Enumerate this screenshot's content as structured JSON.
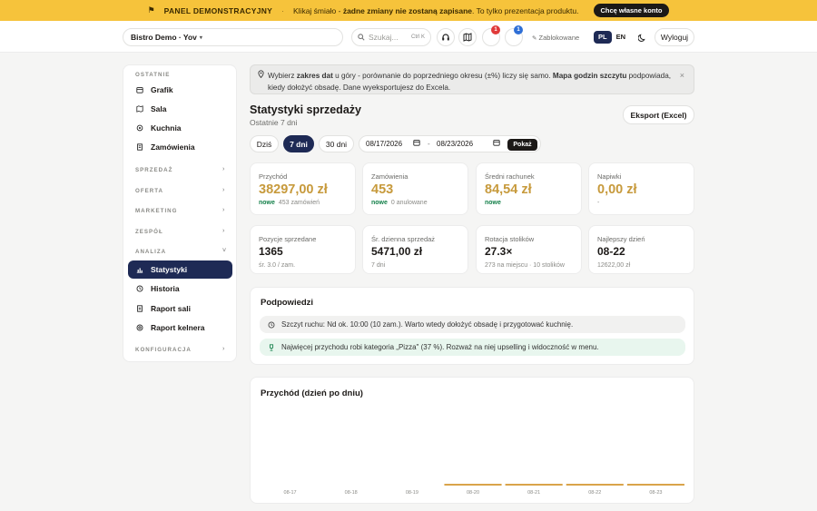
{
  "banner": {
    "flag": "⚑",
    "label": "PANEL DEMONSTRACYJNY",
    "sep": "·",
    "text_a": "Klikaj śmiało -",
    "text_bold": "żadne zmiany nie zostaną zapisane",
    "text_b": ". To tylko prezentacja produktu.",
    "cta": "Chcę własne konto"
  },
  "topbar": {
    "tenant": "Bistro Demo · Yov",
    "tenant_caret": "▾",
    "search_placeholder": "Szukaj...",
    "search_shortcut": "Ctrl K",
    "notif_count_a": "1",
    "notif_count_b": "1",
    "blocked": "Zablokowane",
    "blocked_icon": "✎",
    "lang_pl": "PL",
    "lang_en": "EN",
    "logout": "Wyloguj"
  },
  "sidebar": {
    "recent_title": "OSTATNIE",
    "recent": [
      {
        "label": "Grafik",
        "icon": "calendar-icon"
      },
      {
        "label": "Sala",
        "icon": "map-icon"
      },
      {
        "label": "Kuchnia",
        "icon": "kitchen-icon"
      },
      {
        "label": "Zamówienia",
        "icon": "receipt-icon"
      }
    ],
    "sections": [
      "SPRZEDAŻ",
      "OFERTA",
      "MARKETING",
      "ZESPÓŁ",
      "ANALIZA",
      "KONFIGURACJA"
    ],
    "analysis": [
      {
        "label": "Statystyki",
        "icon": "chart-icon",
        "active": true
      },
      {
        "label": "Historia",
        "icon": "clock-icon"
      },
      {
        "label": "Raport sali",
        "icon": "document-icon"
      },
      {
        "label": "Raport kelnera",
        "icon": "target-icon"
      }
    ]
  },
  "hint": {
    "a": "Wybierz ",
    "b": "zakres dat",
    "c": " u góry - porównanie do poprzedniego okresu (±%) liczy się samo. ",
    "d": "Mapa godzin szczytu",
    "e": " podpowiada, kiedy dołożyć obsadę. Dane wyeksportujesz do Excela.",
    "close": "×"
  },
  "header": {
    "title": "Statystyki sprzedaży",
    "subtitle": "Ostatnie 7 dni",
    "export": "Eksport (Excel)"
  },
  "filters": {
    "today": "Dziś",
    "d7": "7 dni",
    "d30": "30 dni",
    "from": "08/17/2026",
    "to": "08/23/2026",
    "sep": "-",
    "show": "Pokaż"
  },
  "kpis": [
    {
      "label": "Przychód",
      "value": "38297,00 zł",
      "new": "nowe",
      "sub": "453 zamówień"
    },
    {
      "label": "Zamówienia",
      "value": "453",
      "new": "nowe",
      "sub": "0 anulowane"
    },
    {
      "label": "Średni rachunek",
      "value": "84,54 zł",
      "new": "nowe",
      "sub": ""
    },
    {
      "label": "Napiwki",
      "value": "0,00 zł",
      "new": "",
      "sub": "-"
    }
  ],
  "kpis2": [
    {
      "label": "Pozycje sprzedane",
      "value": "1365",
      "sub": "śr. 3.0 / zam."
    },
    {
      "label": "Śr. dzienna sprzedaż",
      "value": "5471,00 zł",
      "sub": "7 dni"
    },
    {
      "label": "Rotacja stolików",
      "value": "27.3×",
      "sub": "273 na miejscu · 10 stolików"
    },
    {
      "label": "Najlepszy dzień",
      "value": "08-22",
      "sub": "12622,00 zł"
    }
  ],
  "tips": {
    "title": "Podpowiedzi",
    "items": [
      {
        "icon": "clock-icon",
        "text": "Szczyt ruchu: Nd ok. 10:00 (10 zam.). Warto wtedy dołożyć obsadę i przygotować kuchnię."
      },
      {
        "icon": "trophy-icon",
        "text": "Najwięcej przychodu robi kategoria „Pizza\" (37 %). Rozważ na niej upselling i widoczność w menu."
      }
    ]
  },
  "chart_data": {
    "type": "bar",
    "title": "Przychód (dzień po dniu)",
    "categories": [
      "08-17",
      "08-18",
      "08-19",
      "08-20",
      "08-21",
      "08-22",
      "08-23"
    ],
    "values": [
      0,
      0,
      0,
      1,
      1,
      1,
      1
    ],
    "bar_color": "#d9a44a"
  }
}
